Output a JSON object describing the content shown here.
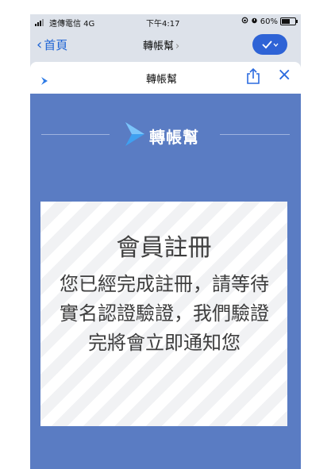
{
  "status_bar": {
    "carrier": "遠傳電信 4G",
    "time": "下午4:17",
    "battery": "60%",
    "status_icons": [
      "rotation-lock-icon",
      "alarm-icon",
      "battery-icon"
    ]
  },
  "nav_bar": {
    "back_label": "首頁",
    "title": "轉帳幫",
    "title_chevron": "›",
    "action_icon": "checkmark-dropdown-icon"
  },
  "sheet": {
    "title": "轉帳幫",
    "close_glyph": "×"
  },
  "webview": {
    "brand_name": "轉帳幫",
    "card_title": "會員註冊",
    "card_message": "您已經完成註冊，請等待實名認證驗證，我們驗證完將會立即通知您"
  },
  "colors": {
    "accent": "#2e63d6",
    "webview_background": "#5a7cc3",
    "card_text": "#3e3e3e"
  }
}
